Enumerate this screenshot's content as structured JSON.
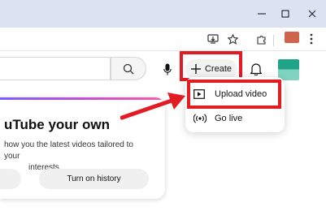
{
  "window": {
    "controls": {
      "minimize": "–",
      "maximize": "□",
      "close": "✕"
    }
  },
  "youtube": {
    "create_label": "Create",
    "create_menu": [
      {
        "label": "Upload video",
        "icon": "upload-video-icon"
      },
      {
        "label": "Go live",
        "icon": "go-live-icon"
      }
    ],
    "history_card": {
      "title": "uTube your own",
      "body_line1": "how you the latest videos tailored to your",
      "body_line2": "interests.",
      "button_label": "Turn on history"
    }
  },
  "colors": {
    "annotation_red": "#e31b23",
    "titlebar": "#dbe2f1"
  }
}
